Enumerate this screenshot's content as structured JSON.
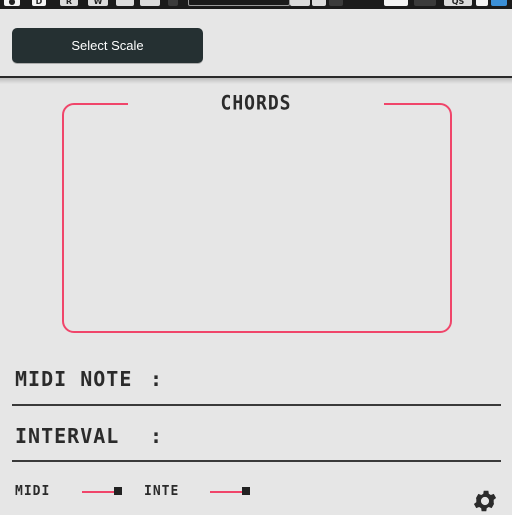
{
  "toolbar": {
    "buttons": [
      {
        "label": "●",
        "icon": "record-icon"
      },
      {
        "label": "D",
        "icon": "d-button"
      },
      {
        "label": "R",
        "icon": "read-button"
      },
      {
        "label": "W",
        "icon": "write-button"
      },
      {
        "label": "",
        "icon": "link-icon"
      },
      {
        "label": "",
        "icon": "arrow-icon"
      }
    ],
    "preset_field": "",
    "right_label": "QS"
  },
  "header": {
    "select_scale_label": "Select Scale"
  },
  "chords": {
    "title": "CHORDS",
    "items": []
  },
  "readouts": {
    "midi_note_label": "MIDI NOTE",
    "midi_note_colon": ":",
    "midi_note_value": "",
    "interval_label": "INTERVAL",
    "interval_colon": ":",
    "interval_value": ""
  },
  "controls": {
    "midi_label": "MIDI",
    "midi_level": 1.0,
    "inte_label": "INTE",
    "inte_level": 1.0
  },
  "colors": {
    "accent": "#f0456a",
    "button_bg": "#253032",
    "panel_bg": "#e6e6e6",
    "text": "#2b2b2b"
  }
}
